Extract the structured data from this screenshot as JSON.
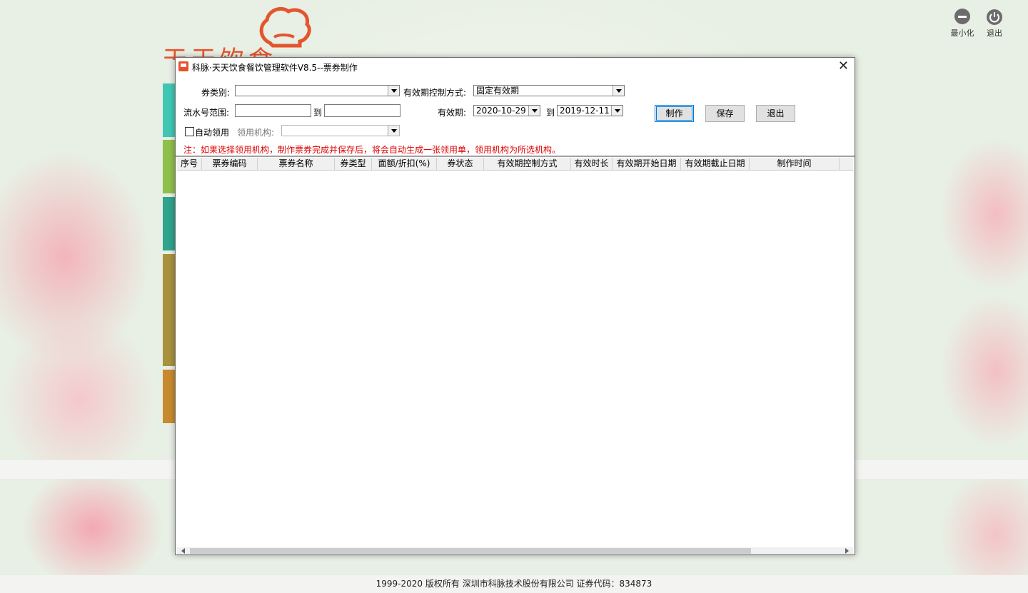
{
  "background": {
    "logo_text": "天天饮食",
    "top_buttons": [
      {
        "label": "最小化",
        "icon": "minus-circle-icon"
      },
      {
        "label": "退出",
        "icon": "power-icon"
      }
    ],
    "footer": "1999-2020  版权所有   深圳市科脉技术股份有限公司   证券代码：834873",
    "tile_colors": [
      "#3fc7b4",
      "#8fc04a",
      "#2fa38c",
      "#a8923e",
      "#c88a2e"
    ]
  },
  "dialog": {
    "title": "科脉·天天饮食餐饮管理软件V8.5--票券制作",
    "close_icon": "close-icon",
    "form": {
      "ticket_type_label": "券类别:",
      "ticket_type_value": "",
      "validity_mode_label": "有效期控制方式:",
      "validity_mode_value": "固定有效期",
      "serial_range_label": "流水号范围:",
      "serial_from": "",
      "to_label": "到",
      "serial_to": "",
      "validity_label": "有效期:",
      "validity_start": "2020-10-29",
      "validity_to_label": "到",
      "validity_end": "2019-12-11",
      "auto_receive_label": "自动领用",
      "auto_receive_checked": false,
      "receive_org_label": "领用机构:",
      "receive_org_value": "",
      "make_button": "制作",
      "save_button": "保存",
      "exit_button": "退出",
      "note": "注：如果选择领用机构，制作票券完成并保存后，将会自动生成一张领用单，领用机构为所选机构。"
    },
    "grid": {
      "columns": [
        "序号",
        "票券编码",
        "票券名称",
        "券类型",
        "面额/折扣(%)",
        "券状态",
        "有效期控制方式",
        "有效时长",
        "有效期开始日期",
        "有效期截止日期",
        "制作时间",
        ""
      ],
      "rows": []
    }
  }
}
